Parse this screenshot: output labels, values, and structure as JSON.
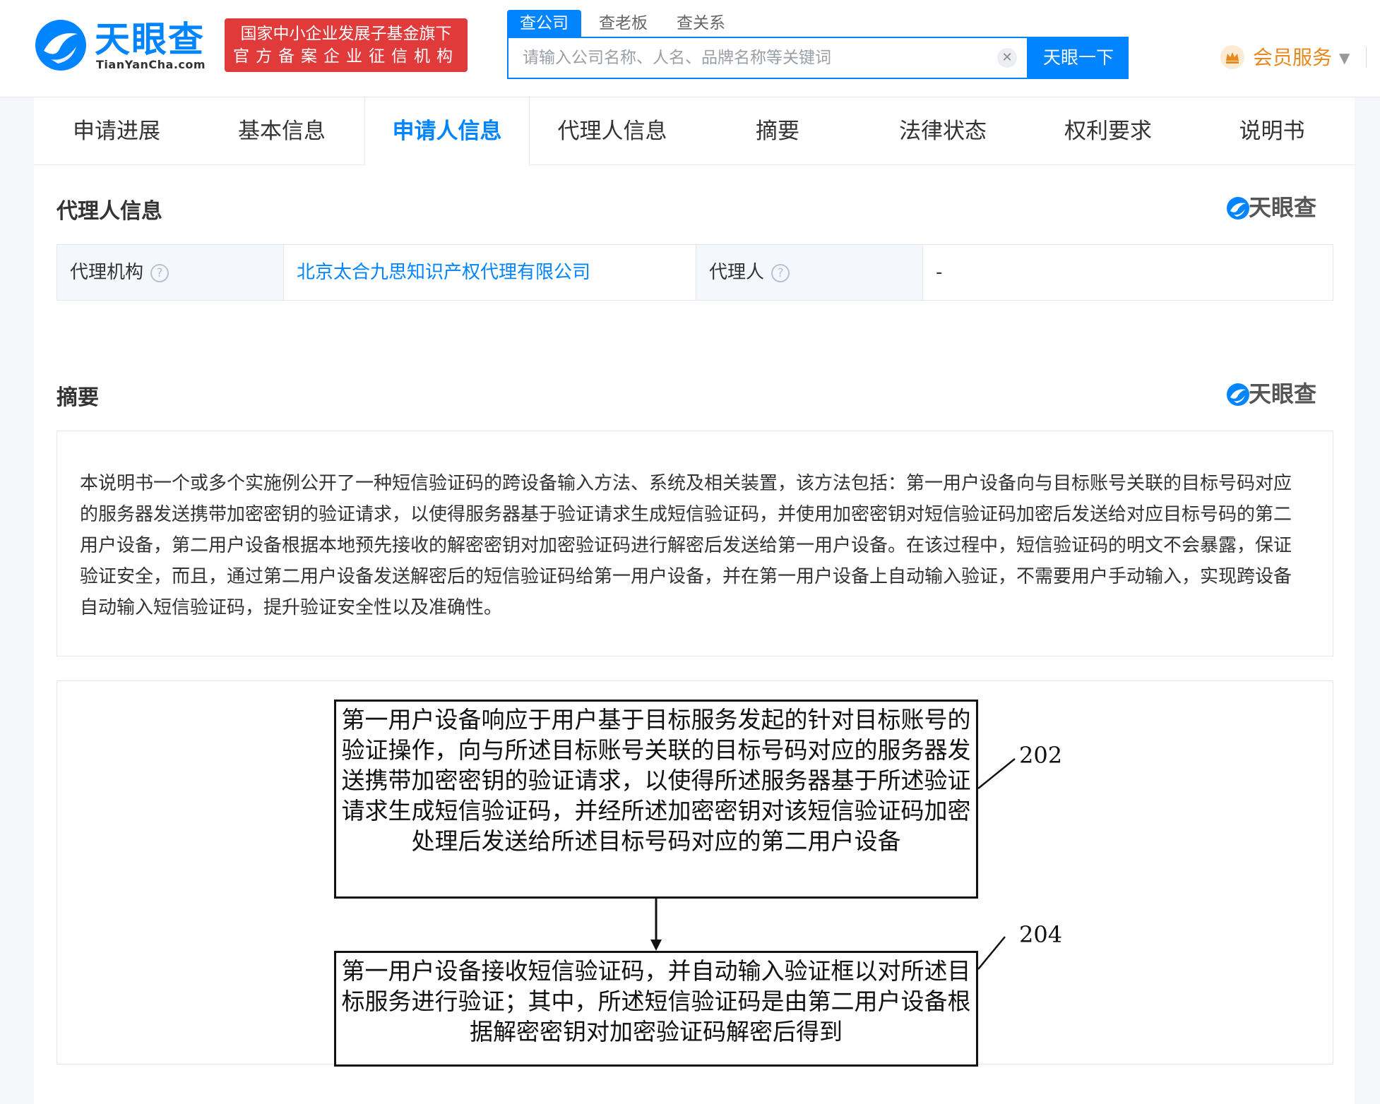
{
  "header": {
    "logo_cn": "天眼查",
    "logo_en": "TianYanCha.com",
    "badge_line1": "国家中小企业发展子基金旗下",
    "badge_line2": "官方备案企业征信机构",
    "search_tabs": [
      "查公司",
      "查老板",
      "查关系"
    ],
    "search_placeholder": "请输入公司名称、人名、品牌名称等关键词",
    "search_button": "天眼一下",
    "vip_label": "会员服务",
    "brand_color": "#0084ff"
  },
  "nav": {
    "tabs": [
      "申请进展",
      "基本信息",
      "申请人信息",
      "代理人信息",
      "摘要",
      "法律状态",
      "权利要求",
      "说明书"
    ],
    "active_index": 2
  },
  "agent_section": {
    "title": "代理人信息",
    "watermark": "天眼查",
    "agency_label": "代理机构",
    "agency_value": "北京太合九思知识产权代理有限公司",
    "agent_label": "代理人",
    "agent_value": "-"
  },
  "abstract_section": {
    "title": "摘要",
    "watermark": "天眼查",
    "text": "本说明书一个或多个实施例公开了一种短信验证码的跨设备输入方法、系统及相关装置，该方法包括：第一用户设备向与目标账号关联的目标号码对应的服务器发送携带加密密钥的验证请求，以使得服务器基于验证请求生成短信验证码，并使用加密密钥对短信验证码加密后发送给对应目标号码的第二用户设备，第二用户设备根据本地预先接收的解密密钥对加密验证码进行解密后发送给第一用户设备。在该过程中，短信验证码的明文不会暴露，保证验证安全，而且，通过第二用户设备发送解密后的短信验证码给第一用户设备，并在第一用户设备上自动输入验证，不需要用户手动输入，实现跨设备自动输入短信验证码，提升验证安全性以及准确性。"
  },
  "figure": {
    "step1": {
      "text": "第一用户设备响应于用户基于目标服务发起的针对目标账号的验证操作，向与所述目标账号关联的目标号码对应的服务器发送携带加密密钥的验证请求，以使得所述服务器基于所述验证请求生成短信验证码，并经所述加密密钥对该短信验证码加密处理后发送给所述目标号码对应的第二用户设备",
      "ref": "202"
    },
    "step2": {
      "text": "第一用户设备接收短信验证码，并自动输入验证框以对所述目标服务进行验证；其中，所述短信验证码是由第二用户设备根据解密密钥对加密验证码解密后得到",
      "ref": "204"
    }
  }
}
